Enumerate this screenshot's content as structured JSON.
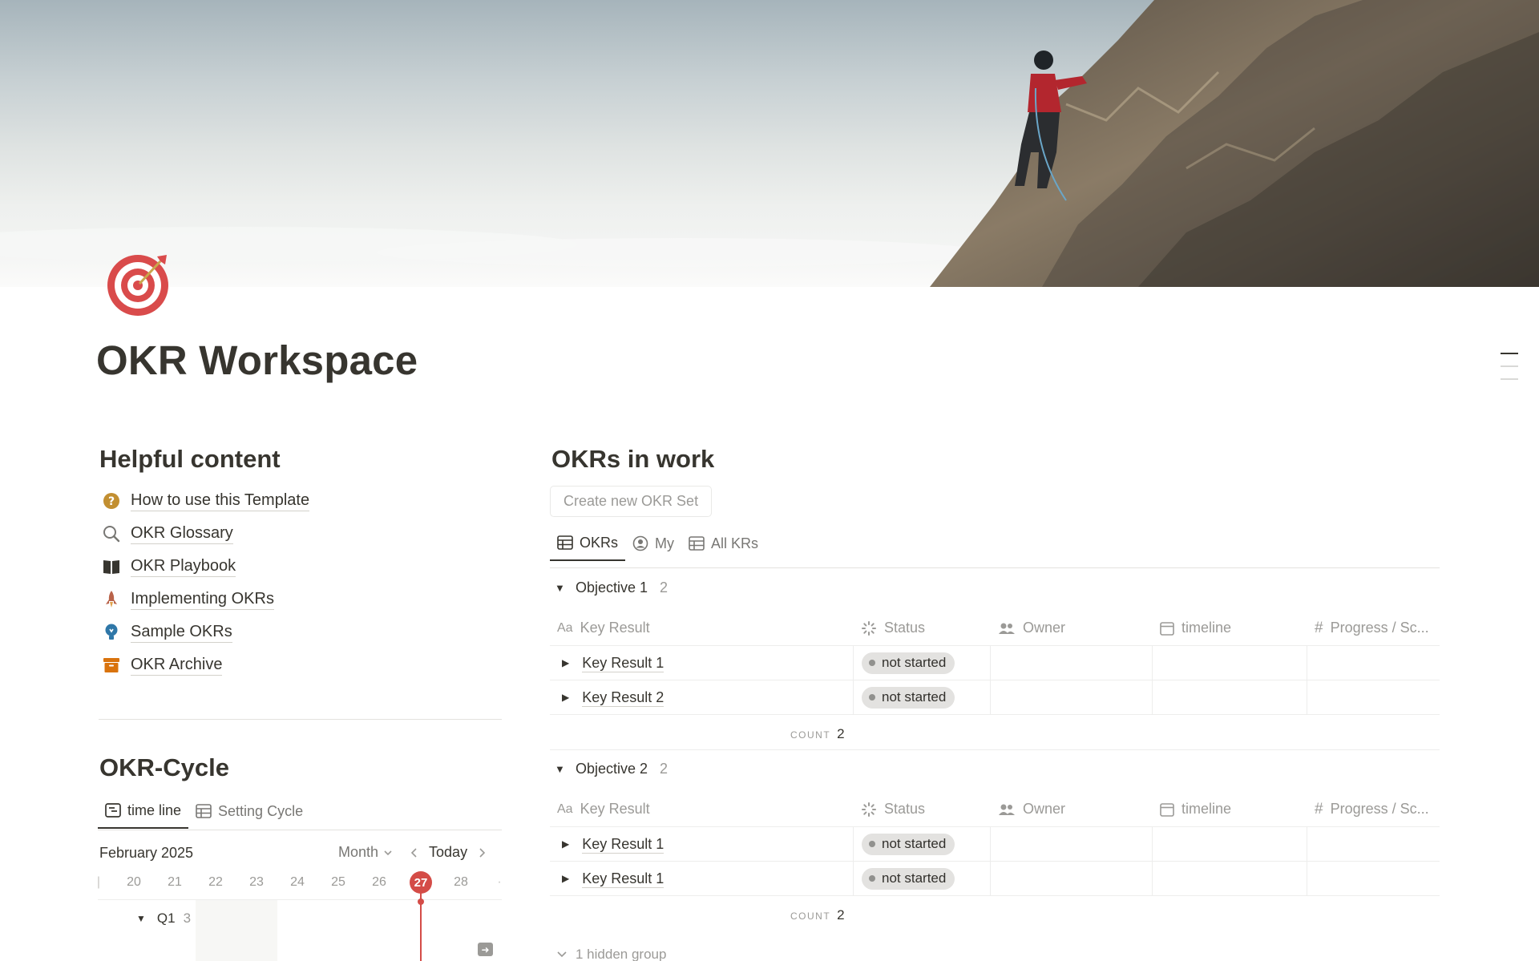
{
  "page": {
    "title": "OKR Workspace",
    "icon": "target-icon"
  },
  "helpful": {
    "heading": "Helpful content",
    "links": [
      {
        "label": "How to use this Template",
        "icon": "question-circle-icon"
      },
      {
        "label": "OKR Glossary",
        "icon": "magnifier-icon"
      },
      {
        "label": "OKR Playbook",
        "icon": "open-book-icon"
      },
      {
        "label": "Implementing OKRs",
        "icon": "rocket-icon"
      },
      {
        "label": "Sample OKRs",
        "icon": "lightbulb-icon"
      },
      {
        "label": "OKR Archive",
        "icon": "archive-box-icon"
      }
    ]
  },
  "cycle": {
    "heading": "OKR-Cycle",
    "tabs": [
      {
        "label": "time line",
        "icon": "timeline-icon",
        "active": true
      },
      {
        "label": "Setting Cycle",
        "icon": "table-icon",
        "active": false
      }
    ],
    "timeline": {
      "month_label": "February 2025",
      "zoom": "Month",
      "today_label": "Today",
      "days": [
        "20",
        "21",
        "22",
        "23",
        "24",
        "25",
        "26",
        "27",
        "28"
      ],
      "today": "27",
      "group": {
        "name": "Q1",
        "count": "3"
      }
    }
  },
  "okrs": {
    "heading": "OKRs in work",
    "create_button": "Create new OKR Set",
    "tabs": [
      {
        "label": "OKRs",
        "icon": "table-icon",
        "active": true
      },
      {
        "label": "My",
        "icon": "person-circle-icon",
        "active": false
      },
      {
        "label": "All KRs",
        "icon": "table-icon",
        "active": false
      }
    ],
    "columns": {
      "key_result": "Key Result",
      "status": "Status",
      "owner": "Owner",
      "timeline": "timeline",
      "progress": "Progress / Sc..."
    },
    "groups": [
      {
        "name": "Objective 1",
        "count": "2",
        "rows": [
          {
            "name": "Key Result 1",
            "status": "not started"
          },
          {
            "name": "Key Result 2",
            "status": "not started"
          }
        ],
        "count_label": "COUNT",
        "count_value": "2"
      },
      {
        "name": "Objective 2",
        "count": "2",
        "rows": [
          {
            "name": "Key Result 1",
            "status": "not started"
          },
          {
            "name": "Key Result 1",
            "status": "not started"
          }
        ],
        "count_label": "COUNT",
        "count_value": "2"
      }
    ],
    "hidden_groups": "1 hidden group"
  },
  "colors": {
    "text": "#37352f",
    "muted": "#9b9a97",
    "accent_red": "#d44c47",
    "pill_bg": "#e3e2e0"
  }
}
